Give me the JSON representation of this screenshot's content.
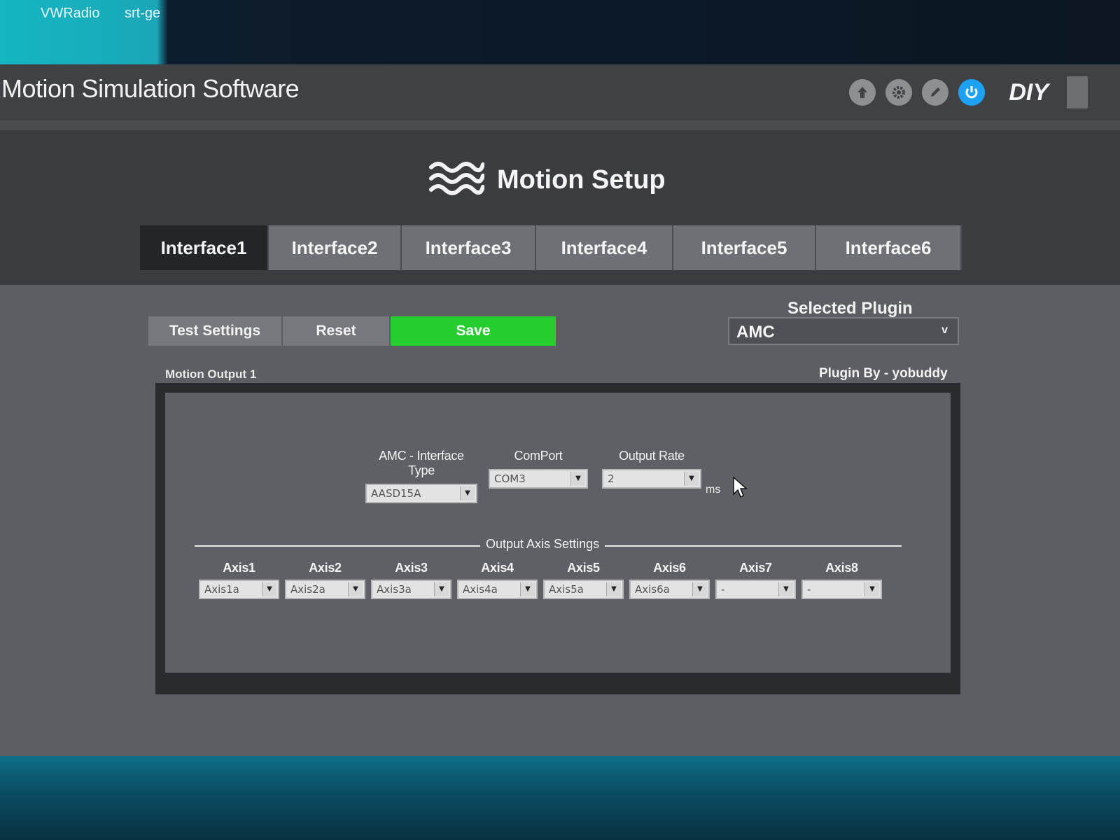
{
  "desktop": {
    "icons": [
      "VWRadio",
      "srt-ge"
    ]
  },
  "app": {
    "title": "Motion Simulation Software",
    "mode_label": "DIY",
    "title_icons": [
      "upload-icon",
      "gear-icon",
      "pencil-icon",
      "power-icon"
    ]
  },
  "header": {
    "title": "Motion Setup",
    "icon": "waves-icon"
  },
  "tabs": [
    {
      "label": "Interface1",
      "active": true
    },
    {
      "label": "Interface2",
      "active": false
    },
    {
      "label": "Interface3",
      "active": false
    },
    {
      "label": "Interface4",
      "active": false
    },
    {
      "label": "Interface5",
      "active": false
    },
    {
      "label": "Interface6",
      "active": false
    }
  ],
  "actions": {
    "test_label": "Test Settings",
    "reset_label": "Reset",
    "save_label": "Save"
  },
  "plugin": {
    "label": "Selected Plugin",
    "selected": "AMC",
    "author": "Plugin By - yobuddy"
  },
  "output": {
    "label": "Motion Output 1",
    "interface_type_label": "AMC - Interface Type",
    "interface_type_value": "AASD15A",
    "comport_label": "ComPort",
    "comport_value": "COM3",
    "output_rate_label": "Output Rate",
    "output_rate_value": "2",
    "output_rate_unit": "ms"
  },
  "axis_settings": {
    "title": "Output Axis Settings",
    "axes": [
      {
        "label": "Axis1",
        "value": "Axis1a"
      },
      {
        "label": "Axis2",
        "value": "Axis2a"
      },
      {
        "label": "Axis3",
        "value": "Axis3a"
      },
      {
        "label": "Axis4",
        "value": "Axis4a"
      },
      {
        "label": "Axis5",
        "value": "Axis5a"
      },
      {
        "label": "Axis6",
        "value": "Axis6a"
      },
      {
        "label": "Axis7",
        "value": "-"
      },
      {
        "label": "Axis8",
        "value": "-"
      }
    ]
  },
  "colors": {
    "save": "#25cd2e",
    "active_icon": "#1da1f2",
    "active_tab": "#242528"
  }
}
